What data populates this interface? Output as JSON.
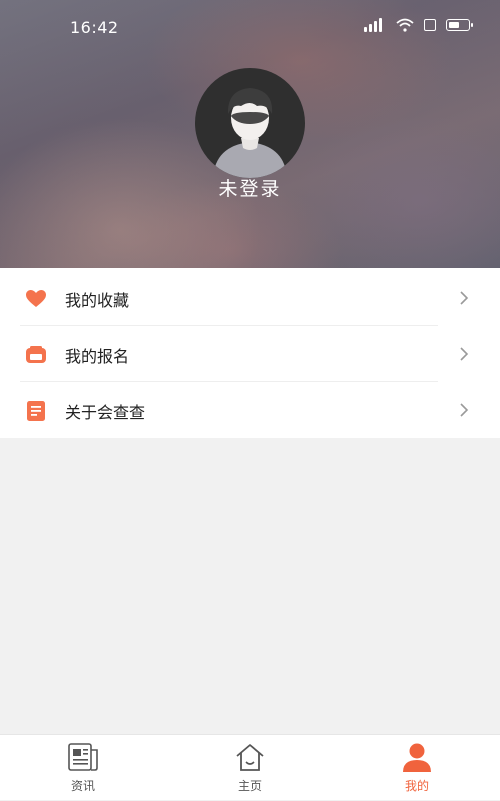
{
  "status_bar": {
    "time": "16:42"
  },
  "profile": {
    "login_status": "未登录"
  },
  "menu": {
    "items": [
      {
        "label": "我的收藏",
        "icon": "heart-icon"
      },
      {
        "label": "我的报名",
        "icon": "register-icon"
      },
      {
        "label": "关于会查查",
        "icon": "document-icon"
      }
    ]
  },
  "bottom_nav": {
    "items": [
      {
        "label": "资讯",
        "icon": "news-icon",
        "active": false
      },
      {
        "label": "主页",
        "icon": "home-icon",
        "active": false
      },
      {
        "label": "我的",
        "icon": "profile-icon",
        "active": true
      }
    ]
  },
  "colors": {
    "accent": "#f0633d",
    "icon_orange": "#f4734d",
    "background": "#f1f1f1"
  }
}
